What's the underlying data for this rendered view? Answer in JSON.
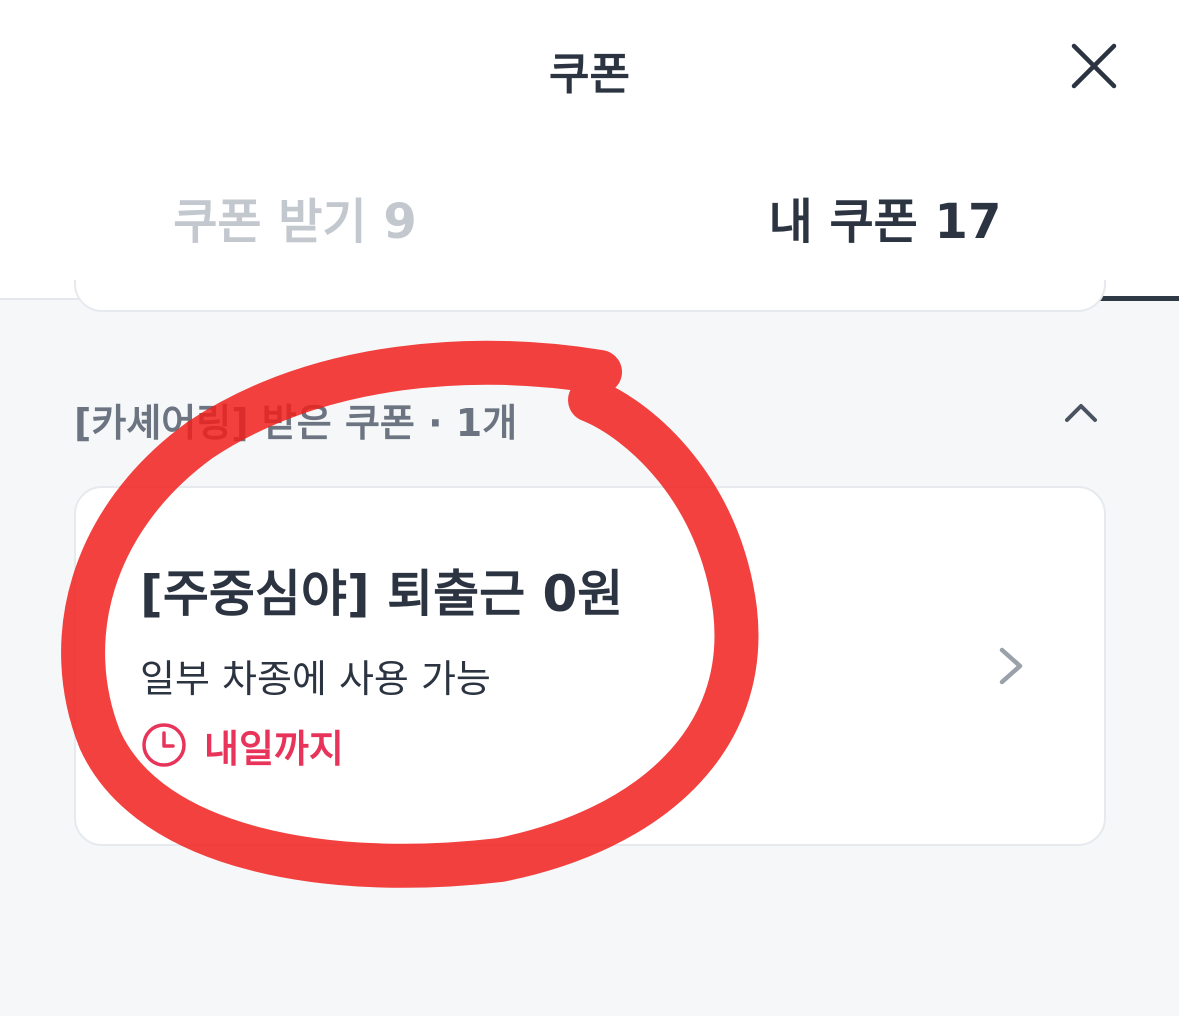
{
  "header": {
    "title": "쿠폰",
    "close_icon": "close-icon"
  },
  "tabs": [
    {
      "label": "쿠폰 받기 9",
      "active": false
    },
    {
      "label": "내 쿠폰 17",
      "active": true
    }
  ],
  "section": {
    "title": "[카셰어링] 받은 쿠폰 · 1개",
    "toggle_icon": "chevron-up-icon"
  },
  "coupon": {
    "title": "[주중심야] 퇴출근 0원",
    "description": "일부 차종에 사용 가능",
    "expiry": "내일까지",
    "expiry_icon": "clock-icon",
    "arrow_icon": "chevron-right-icon"
  },
  "colors": {
    "background": "#f6f7f9",
    "text_primary": "#2b3440",
    "tab_inactive": "#c3c8cf",
    "expiry_accent": "#e8345a",
    "annotation_marker": "#f0201c"
  }
}
